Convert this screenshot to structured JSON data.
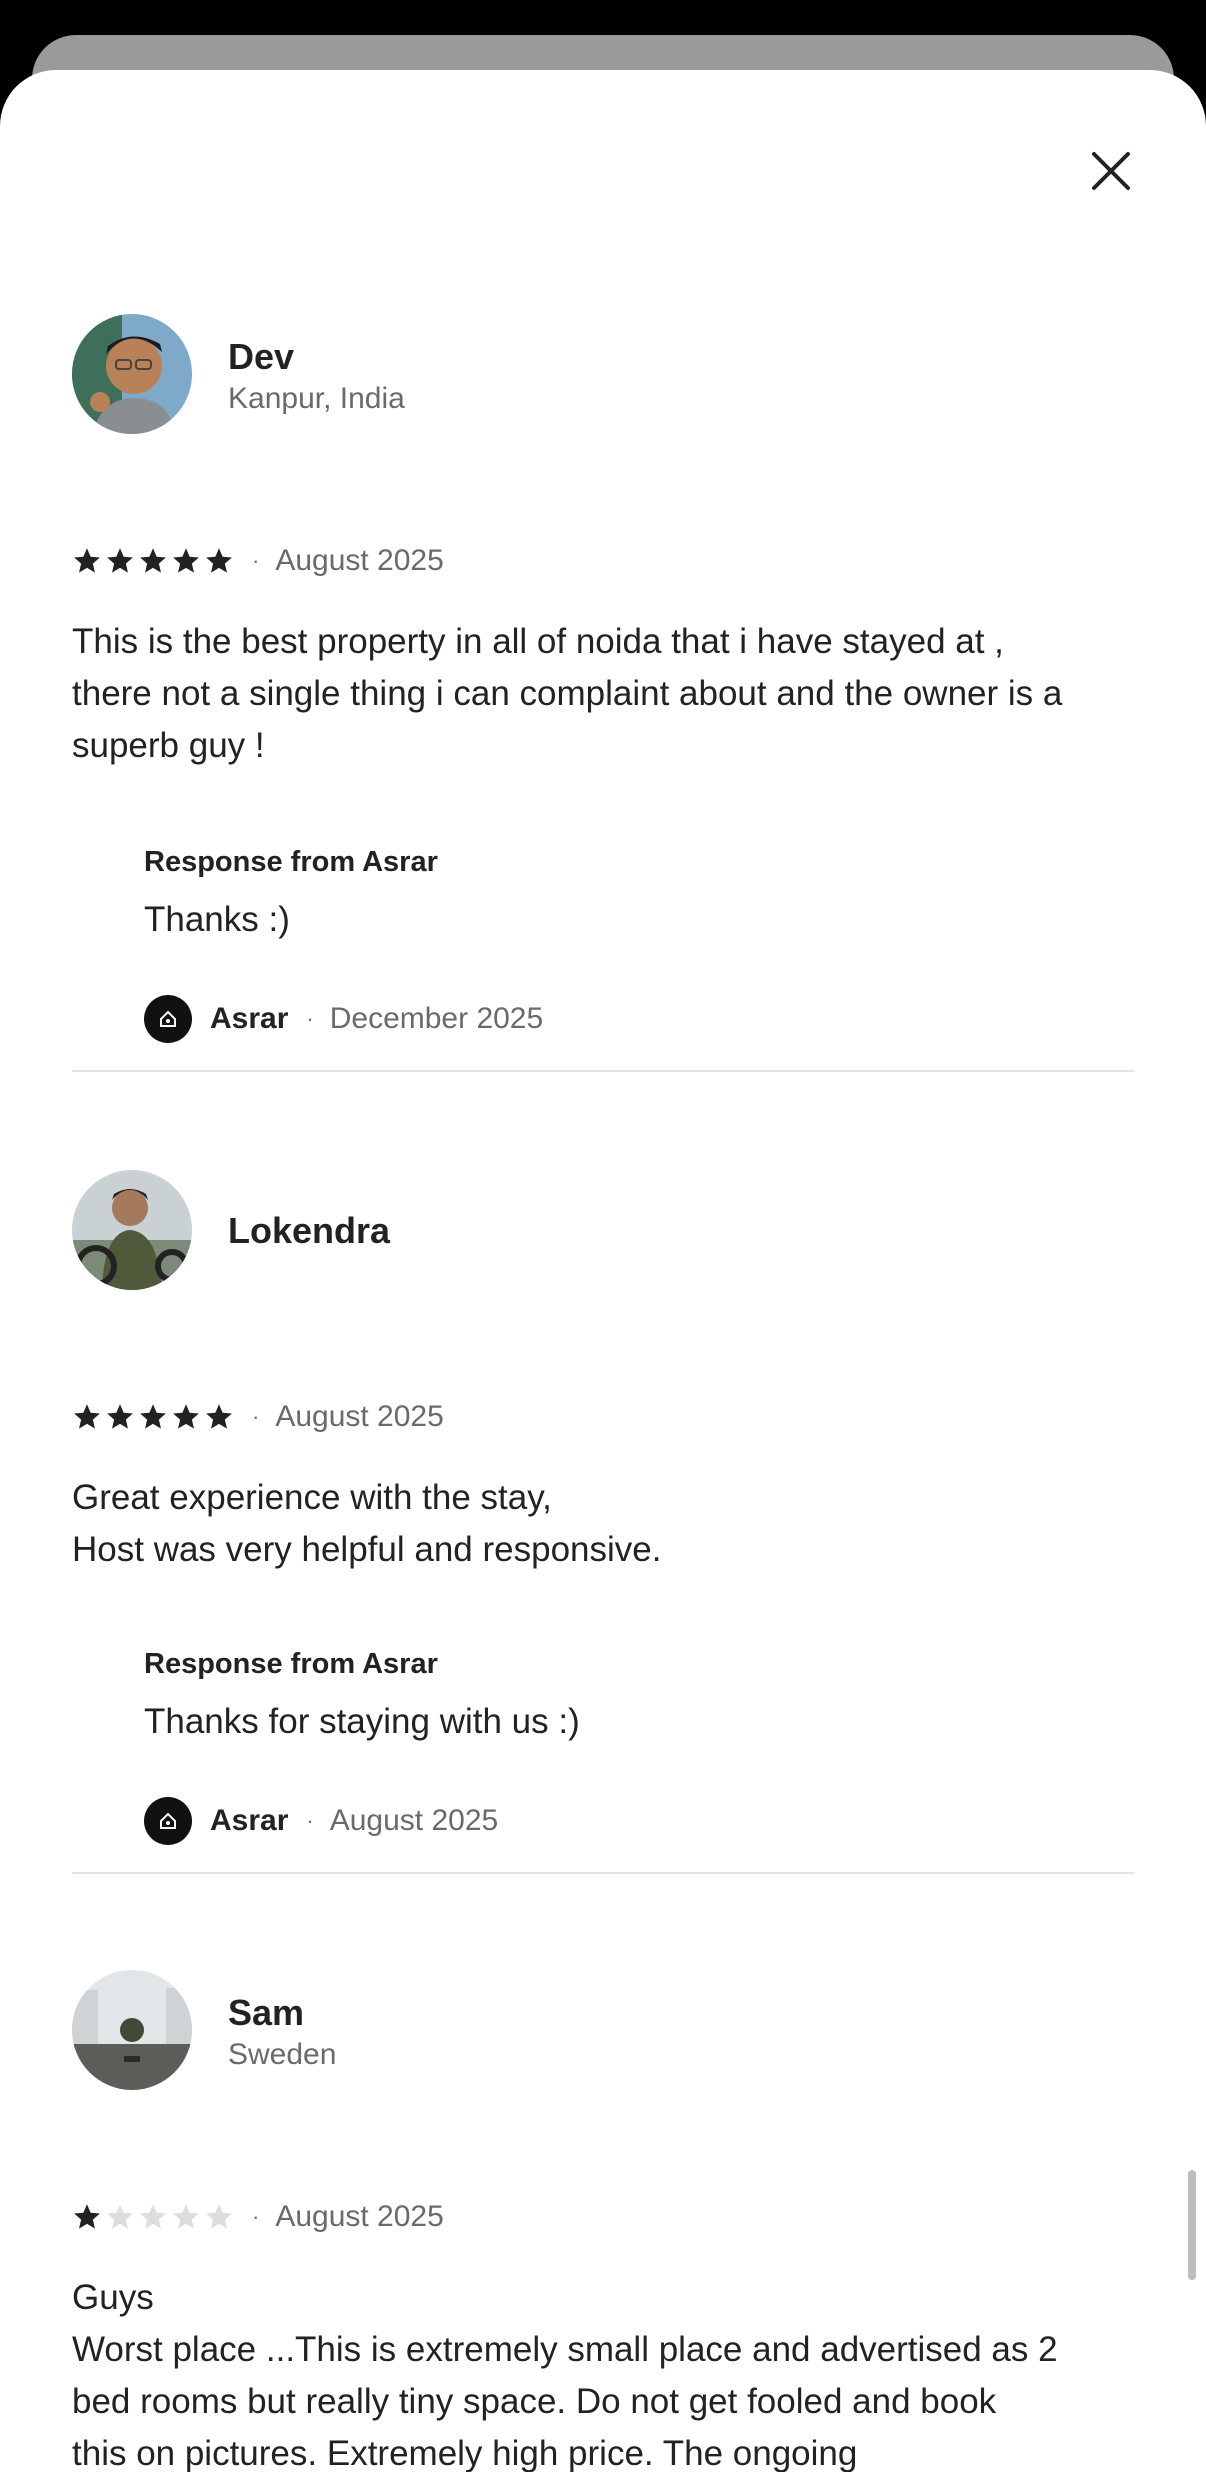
{
  "close_icon": "close-icon",
  "reviews": [
    {
      "name": "Dev",
      "location": "Kanpur, India",
      "rating": 5,
      "date": "August 2025",
      "text": "This is the best property in all of noida that i have stayed at ,\nthere not a single thing i can complaint about and the owner is a\nsuperb guy !",
      "response": {
        "title": "Response from Asrar",
        "text": "Thanks :)",
        "host_name": "Asrar",
        "date": "December 2025"
      }
    },
    {
      "name": "Lokendra",
      "location": "",
      "rating": 5,
      "date": "August 2025",
      "text": "Great experience with the stay,\nHost was very helpful and responsive.",
      "response": {
        "title": "Response from Asrar",
        "text": "Thanks for staying with us :)",
        "host_name": "Asrar",
        "date": "August 2025"
      }
    },
    {
      "name": "Sam",
      "location": "Sweden",
      "rating": 1,
      "date": "August 2025",
      "text": "Guys\nWorst place ...This is extremely small place and advertised as 2\nbed rooms but really tiny space. Do not get fooled and book\nthis on pictures. Extremely high price.  The ongoing\nconstruction onsite is a big nightmare that even weekends"
    }
  ],
  "colors": {
    "star_filled": "#222222",
    "star_empty": "#dddddd",
    "secondary_text": "#6a6a6a"
  }
}
